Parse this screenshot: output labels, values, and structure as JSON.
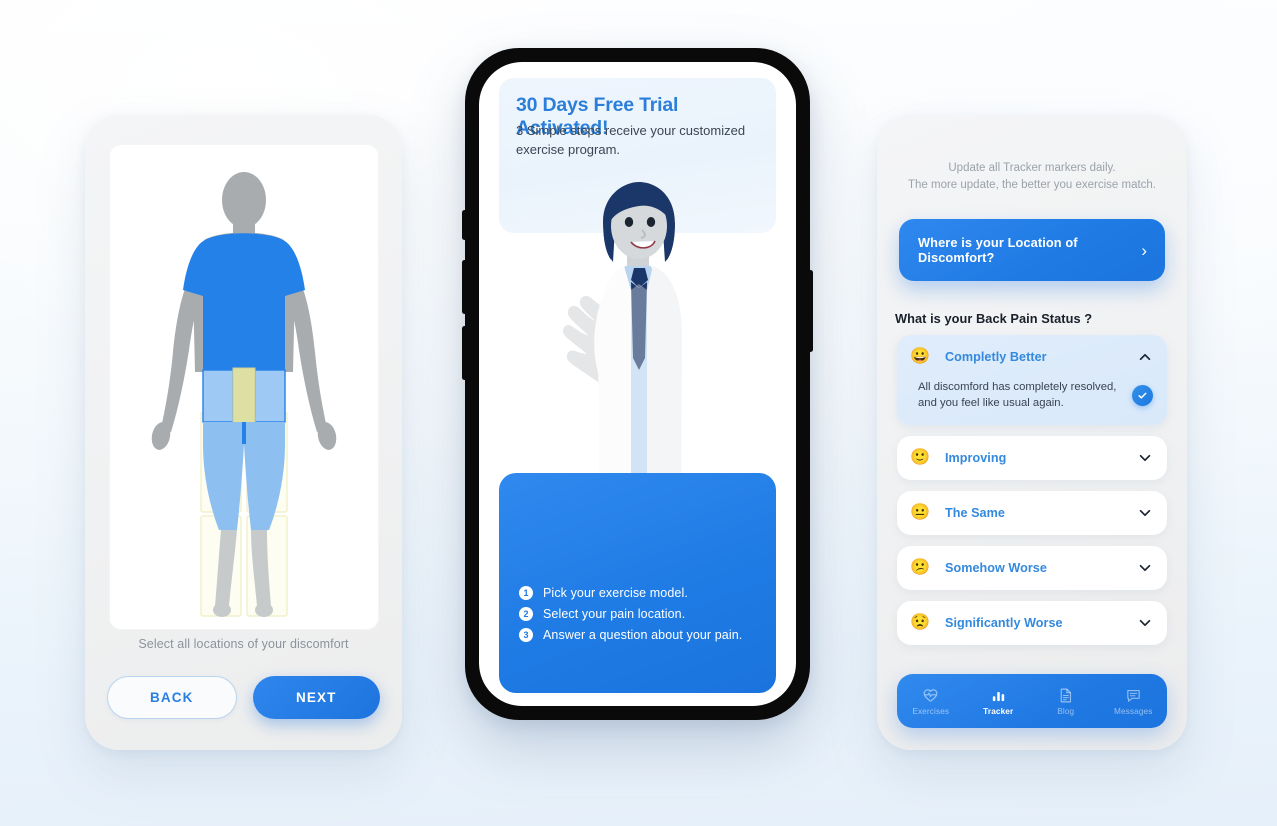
{
  "left_screen": {
    "caption": "Select all locations of your discomfort",
    "back_label": "BACK",
    "next_label": "NEXT",
    "body_alt": "back-view-human-body-region-selector"
  },
  "center_screen": {
    "hero_title": "30 Days Free Trial Activated!",
    "hero_subtitle": "3 Simple steps receive your customized exercise program.",
    "illustration_alt": "waving-doctor-illustration",
    "steps": [
      {
        "num": "1",
        "text": "Pick your exercise model."
      },
      {
        "num": "2",
        "text": "Select your pain location."
      },
      {
        "num": "3",
        "text": "Answer a question about your pain."
      }
    ]
  },
  "right_screen": {
    "hint_line1": "Update all Tracker markers daily.",
    "hint_line2": "The more update, the better you exercise match.",
    "location_button": "Where is your Location of Discomfort?",
    "status_question": "What is your Back Pain Status ?",
    "options": [
      {
        "emoji": "😀",
        "label": "Completly Better",
        "expanded": true,
        "description": "All discomford has completely resolved, and you feel like usual again.",
        "selected": true
      },
      {
        "emoji": "🙂",
        "label": "Improving",
        "expanded": false
      },
      {
        "emoji": "😐",
        "label": "The Same",
        "expanded": false
      },
      {
        "emoji": "😕",
        "label": "Somehow Worse",
        "expanded": false
      },
      {
        "emoji": "😟",
        "label": "Significantly Worse",
        "expanded": false
      }
    ],
    "nav": [
      {
        "label": "Exercises",
        "icon": "heart-pulse-icon",
        "active": false
      },
      {
        "label": "Tracker",
        "icon": "bar-chart-icon",
        "active": true
      },
      {
        "label": "Blog",
        "icon": "document-icon",
        "active": false
      },
      {
        "label": "Messages",
        "icon": "chat-bubble-icon",
        "active": false
      }
    ]
  },
  "colors": {
    "accent_blue": "#1e7ae4",
    "light_blue": "#3389dd",
    "page_bg": "#eaf3fb",
    "card_bg": "#f1f2f3"
  }
}
